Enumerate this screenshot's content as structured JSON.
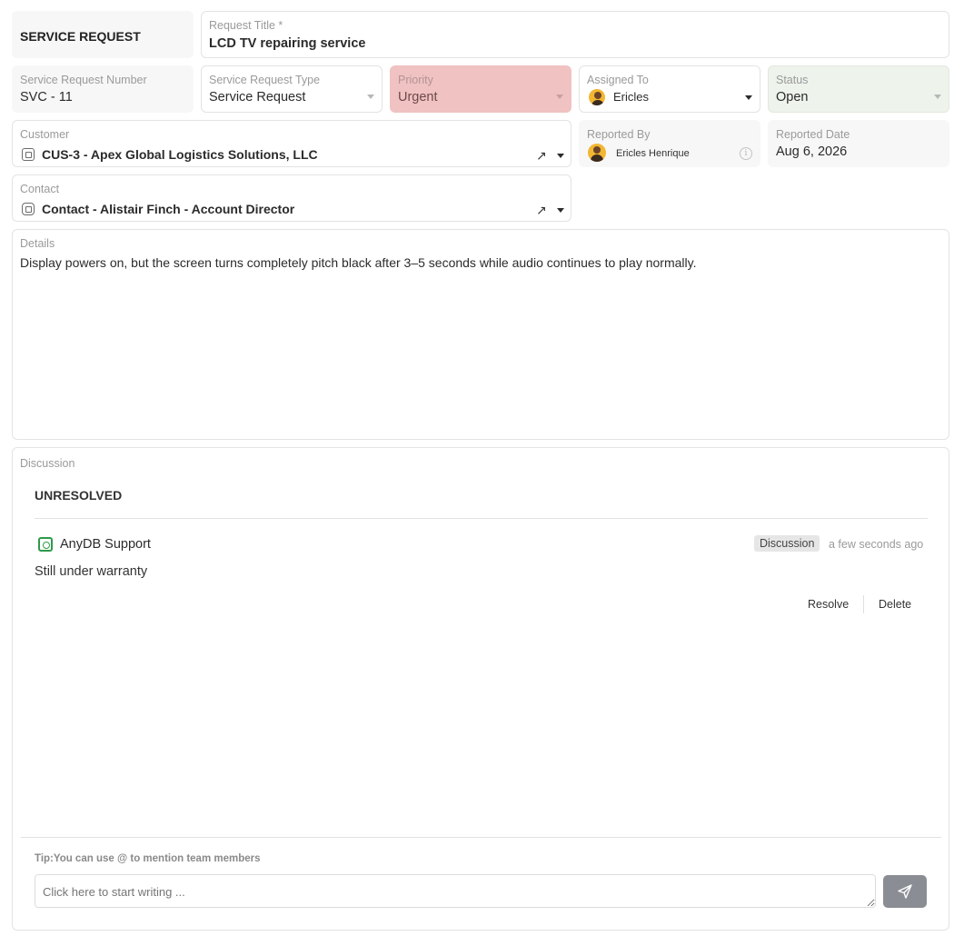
{
  "header": {
    "section_title": "SERVICE REQUEST",
    "request_title_label": "Request Title *",
    "request_title_value": "LCD TV repairing service"
  },
  "fields": {
    "number_label": "Service Request Number",
    "number_value": "SVC - 11",
    "type_label": "Service Request Type",
    "type_value": "Service Request",
    "priority_label": "Priority",
    "priority_value": "Urgent",
    "priority_color": "#f0c2c2",
    "assigned_label": "Assigned To",
    "assigned_value": "Ericles",
    "status_label": "Status",
    "status_value": "Open",
    "status_color": "#eef3ec",
    "customer_label": "Customer",
    "customer_value": "CUS-3 - Apex Global Logistics Solutions, LLC",
    "reported_by_label": "Reported By",
    "reported_by_value": "Ericles Henrique",
    "reported_date_label": "Reported Date",
    "reported_date_value": "Aug 6, 2026",
    "contact_label": "Contact",
    "contact_value": "Contact - Alistair Finch - Account Director",
    "details_label": "Details",
    "details_value": "Display powers on, but the screen turns completely pitch black after 3–5 seconds while audio continues to play normally."
  },
  "discussion": {
    "label": "Discussion",
    "group_title": "UNRESOLVED",
    "comment": {
      "author": "AnyDB Support",
      "author_icon": "anydb-logo-icon",
      "badge": "Discussion",
      "time": "a few seconds ago",
      "text": "Still under warranty",
      "resolve_label": "Resolve",
      "delete_label": "Delete"
    },
    "tip_prefix": "Tip:",
    "tip_text": "You can use @ to mention team members",
    "composer_placeholder": "Click here to start writing ...",
    "send_icon": "send-icon"
  }
}
